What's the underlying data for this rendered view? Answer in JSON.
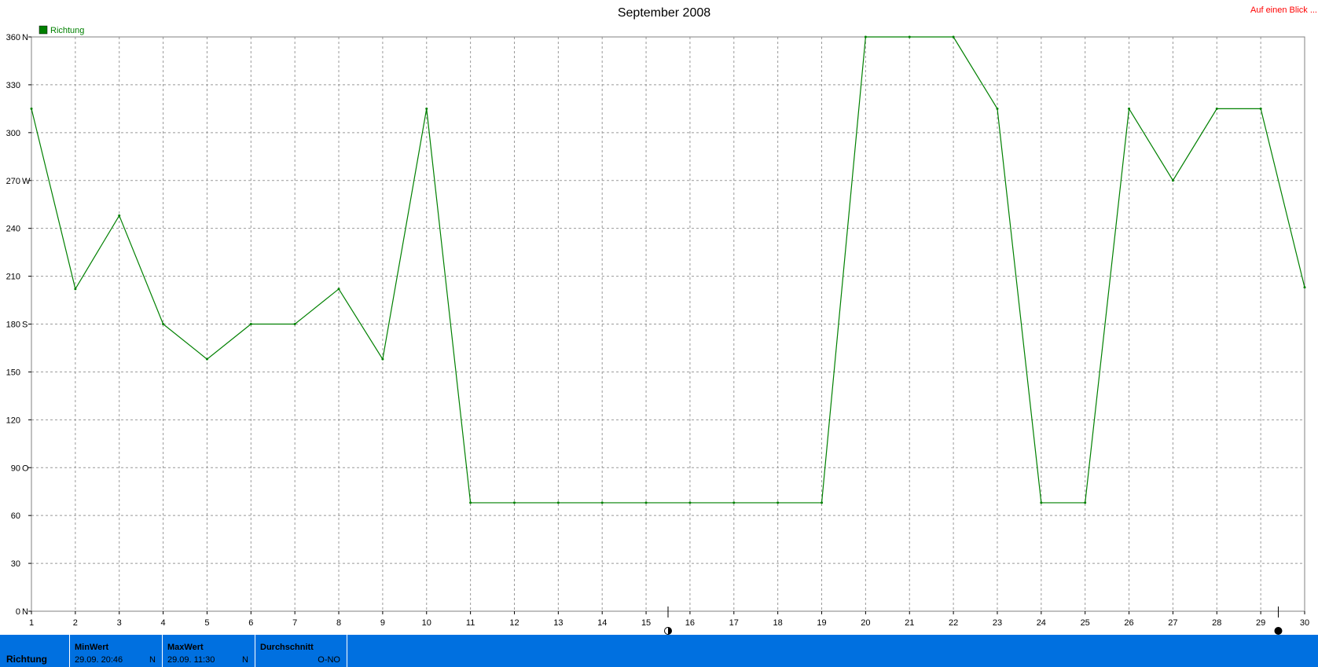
{
  "page": {
    "title": "September 2008",
    "link_label": "Auf einen Blick ...",
    "link_color": "#ff0000"
  },
  "chart_data": {
    "type": "line",
    "title": "September 2008",
    "x": [
      1,
      2,
      3,
      4,
      5,
      6,
      7,
      8,
      9,
      10,
      11,
      12,
      13,
      14,
      15,
      16,
      17,
      18,
      19,
      20,
      21,
      22,
      23,
      24,
      25,
      26,
      27,
      28,
      29,
      30
    ],
    "xlim": [
      1,
      30
    ],
    "ylim": [
      0,
      360
    ],
    "y_ticks": [
      {
        "value": 0,
        "label": "0",
        "dir": "N"
      },
      {
        "value": 30,
        "label": "30",
        "dir": ""
      },
      {
        "value": 60,
        "label": "60",
        "dir": ""
      },
      {
        "value": 90,
        "label": "90",
        "dir": "O"
      },
      {
        "value": 120,
        "label": "120",
        "dir": ""
      },
      {
        "value": 150,
        "label": "150",
        "dir": ""
      },
      {
        "value": 180,
        "label": "180",
        "dir": "S"
      },
      {
        "value": 210,
        "label": "210",
        "dir": ""
      },
      {
        "value": 240,
        "label": "240",
        "dir": ""
      },
      {
        "value": 270,
        "label": "270",
        "dir": "W"
      },
      {
        "value": 300,
        "label": "300",
        "dir": ""
      },
      {
        "value": 330,
        "label": "330",
        "dir": ""
      },
      {
        "value": 360,
        "label": "360",
        "dir": "N"
      }
    ],
    "x_ticks": [
      "1",
      "2",
      "3",
      "4",
      "5",
      "6",
      "7",
      "8",
      "9",
      "10",
      "11",
      "12",
      "13",
      "14",
      "15",
      "16",
      "17",
      "18",
      "19",
      "20",
      "21",
      "22",
      "23",
      "24",
      "25",
      "26",
      "27",
      "28",
      "29",
      "30"
    ],
    "grid": true,
    "legend_position": "top-left",
    "series": [
      {
        "name": "Richtung",
        "color": "#008000",
        "values": [
          315,
          202,
          248,
          180,
          158,
          180,
          180,
          202,
          158,
          315,
          68,
          68,
          68,
          68,
          68,
          68,
          68,
          68,
          68,
          360,
          360,
          360,
          315,
          68,
          68,
          315,
          270,
          315,
          315,
          203
        ]
      }
    ],
    "moon_phases": [
      {
        "day": 15.5,
        "phase": "first-quarter"
      },
      {
        "day": 29.4,
        "phase": "new-moon"
      }
    ]
  },
  "stats": {
    "bar_color": "#0070e0",
    "row_label": "Richtung",
    "min": {
      "header": "MinWert",
      "time": "29.09.  20:46",
      "unit": "N"
    },
    "max": {
      "header": "MaxWert",
      "time": "29.09.  11:30",
      "unit": "N"
    },
    "avg": {
      "header": "Durchschnitt",
      "value": "O-NO"
    }
  }
}
